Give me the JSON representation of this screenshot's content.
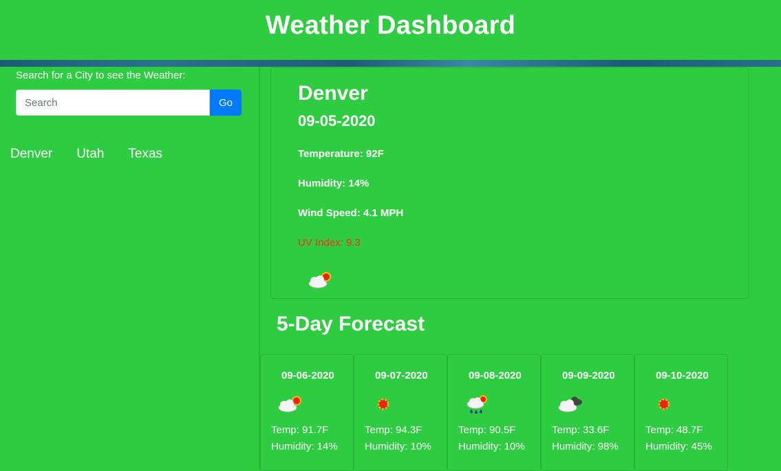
{
  "header": {
    "title": "Weather Dashboard"
  },
  "search": {
    "label": "Search for a City to see the Weather:",
    "placeholder": "Search",
    "value": "",
    "button_label": "Go"
  },
  "history": [
    "Denver",
    "Utah",
    "Texas"
  ],
  "current": {
    "city": "Denver",
    "date": "09-05-2020",
    "temperature": "Temperature: 92F",
    "humidity": "Humidity: 14%",
    "wind": "Wind Speed: 4.1 MPH",
    "uv": "UV Index: 9.3",
    "uv_color": "#ff2a1a",
    "icon": "partly-cloudy-icon"
  },
  "forecast_title": "5-Day Forecast",
  "forecast": [
    {
      "date": "09-06-2020",
      "icon": "partly-cloudy-icon",
      "temp": "Temp: 91.7F",
      "humidity": "Humidity: 14%"
    },
    {
      "date": "09-07-2020",
      "icon": "sun-icon",
      "temp": "Temp: 94.3F",
      "humidity": "Humidity: 10%"
    },
    {
      "date": "09-08-2020",
      "icon": "rain-sun-icon",
      "temp": "Temp: 90.5F",
      "humidity": "Humidity: 10%"
    },
    {
      "date": "09-09-2020",
      "icon": "cloudy-icon",
      "temp": "Temp: 33.6F",
      "humidity": "Humidity: 98%"
    },
    {
      "date": "09-10-2020",
      "icon": "sun-icon",
      "temp": "Temp: 48.7F",
      "humidity": "Humidity: 45%"
    }
  ],
  "colors": {
    "background": "#2ecc40",
    "button": "#007bff",
    "uv_high": "#ff2a1a"
  }
}
